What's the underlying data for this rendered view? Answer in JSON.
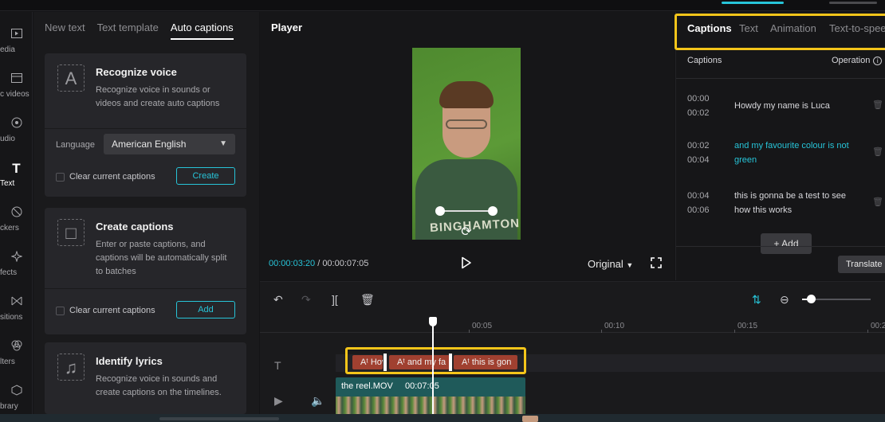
{
  "rail": {
    "items": [
      {
        "label": "edia",
        "icon": "media-icon"
      },
      {
        "label": "c videos",
        "icon": "stock-videos-icon"
      },
      {
        "label": "udio",
        "icon": "audio-icon"
      },
      {
        "label": "Text",
        "icon": "text-icon"
      },
      {
        "label": "ckers",
        "icon": "stickers-icon"
      },
      {
        "label": "fects",
        "icon": "effects-icon"
      },
      {
        "label": "sitions",
        "icon": "transitions-icon"
      },
      {
        "label": "lters",
        "icon": "filters-icon"
      },
      {
        "label": "brary",
        "icon": "library-icon"
      }
    ]
  },
  "text_panel": {
    "tabs": [
      "New text",
      "Text template",
      "Auto captions"
    ],
    "recognize": {
      "title": "Recognize voice",
      "desc": "Recognize voice in sounds or videos and create auto captions",
      "language_label": "Language",
      "language_value": "American English",
      "clear_label": "Clear current captions",
      "button": "Create"
    },
    "create": {
      "title": "Create captions",
      "desc": "Enter or paste captions, and captions will be automatically split to batches",
      "clear_label": "Clear current captions",
      "button": "Add"
    },
    "lyrics": {
      "title": "Identify lyrics",
      "desc": "Recognize voice in sounds and create captions on the timelines."
    }
  },
  "player": {
    "title": "Player",
    "current_time": "00:00:03:20",
    "separator": "/",
    "total_time": "00:00:07:05",
    "ratio": "Original",
    "shirt_text": "BINGHAMTON"
  },
  "captions_panel": {
    "tabs": [
      "Captions",
      "Text",
      "Animation",
      "Text-to-spee"
    ],
    "list_title": "Captions",
    "operation": "Operation",
    "rows": [
      {
        "start": "00:00",
        "end": "00:02",
        "text": "Howdy my name is Luca"
      },
      {
        "start": "00:02",
        "end": "00:04",
        "text": "and my favourite colour is not green"
      },
      {
        "start": "00:04",
        "end": "00:06",
        "text": "this is gonna be a test to see how this works"
      }
    ],
    "add_button": "+ Add",
    "translate_button": "Translate"
  },
  "timeline": {
    "ruler": [
      "00:05",
      "00:10",
      "00:15",
      "00:2"
    ],
    "clips": [
      "Hov",
      "and my fa",
      "this is gon"
    ],
    "video_name": "the reel.MOV",
    "video_duration": "00:07:05"
  },
  "colors": {
    "accent": "#27c4d8",
    "highlight": "#f4c51a",
    "caption_clip": "#a04030",
    "video_clip": "#1f5a5a"
  }
}
